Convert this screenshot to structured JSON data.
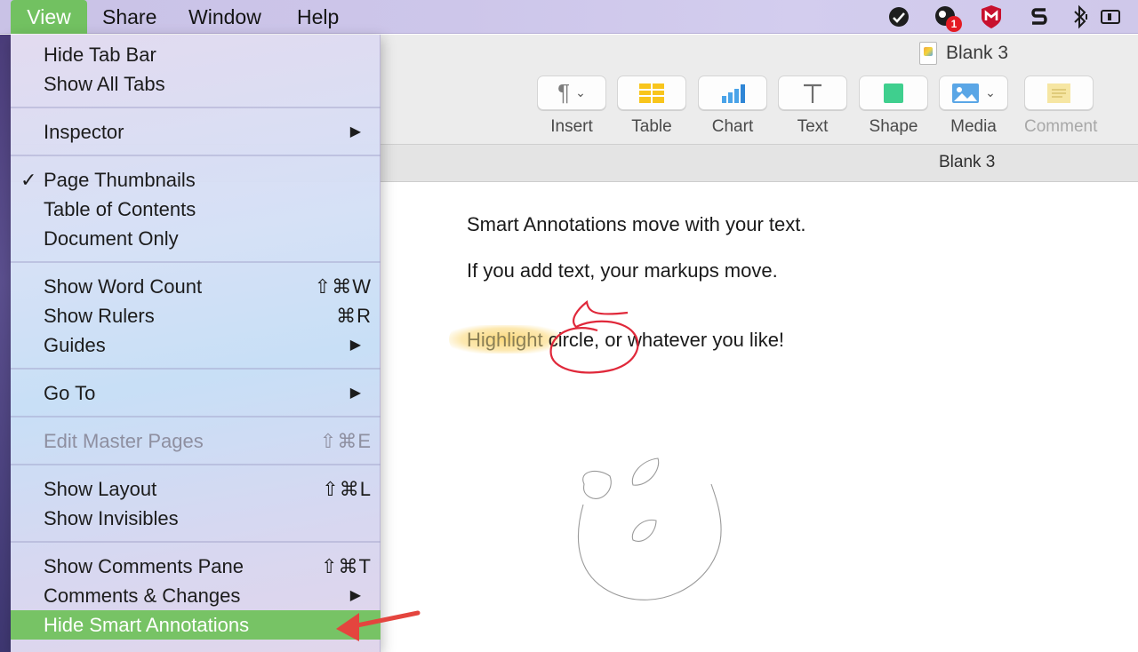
{
  "menubar": {
    "items": [
      "View",
      "Share",
      "Window",
      "Help"
    ],
    "active": "View",
    "status_badge": "1"
  },
  "window": {
    "title": "Blank 3",
    "tab_title": "Blank 3"
  },
  "toolbar": {
    "insert": "Insert",
    "table": "Table",
    "chart": "Chart",
    "text": "Text",
    "shape": "Shape",
    "media": "Media",
    "comment": "Comment"
  },
  "document": {
    "line1": "Smart Annotations move with your text.",
    "line2": "If you add text, your markups move.",
    "line3_highlight": "Highlight",
    "line3_rest": " circle, or whatever you like!"
  },
  "view_menu": {
    "hide_tab_bar": "Hide Tab Bar",
    "show_all_tabs": "Show All Tabs",
    "inspector": "Inspector",
    "page_thumbnails": "Page Thumbnails",
    "table_of_contents": "Table of Contents",
    "document_only": "Document Only",
    "show_word_count": "Show Word Count",
    "show_word_count_sc": "⇧⌘W",
    "show_rulers": "Show Rulers",
    "show_rulers_sc": "⌘R",
    "guides": "Guides",
    "go_to": "Go To",
    "edit_master_pages": "Edit Master Pages",
    "edit_master_pages_sc": "⇧⌘E",
    "show_layout": "Show Layout",
    "show_layout_sc": "⇧⌘L",
    "show_invisibles": "Show Invisibles",
    "show_comments_pane": "Show Comments Pane",
    "show_comments_pane_sc": "⇧⌘T",
    "comments_changes": "Comments & Changes",
    "hide_smart_annotations": "Hide Smart Annotations",
    "check_mark": "✓",
    "submenu_arrow": "▶"
  },
  "colors": {
    "menu_highlight": "#77c365",
    "annotation_arrow": "#e4453e",
    "circle_ink": "#e0283a",
    "highlighter": "#facd50"
  }
}
